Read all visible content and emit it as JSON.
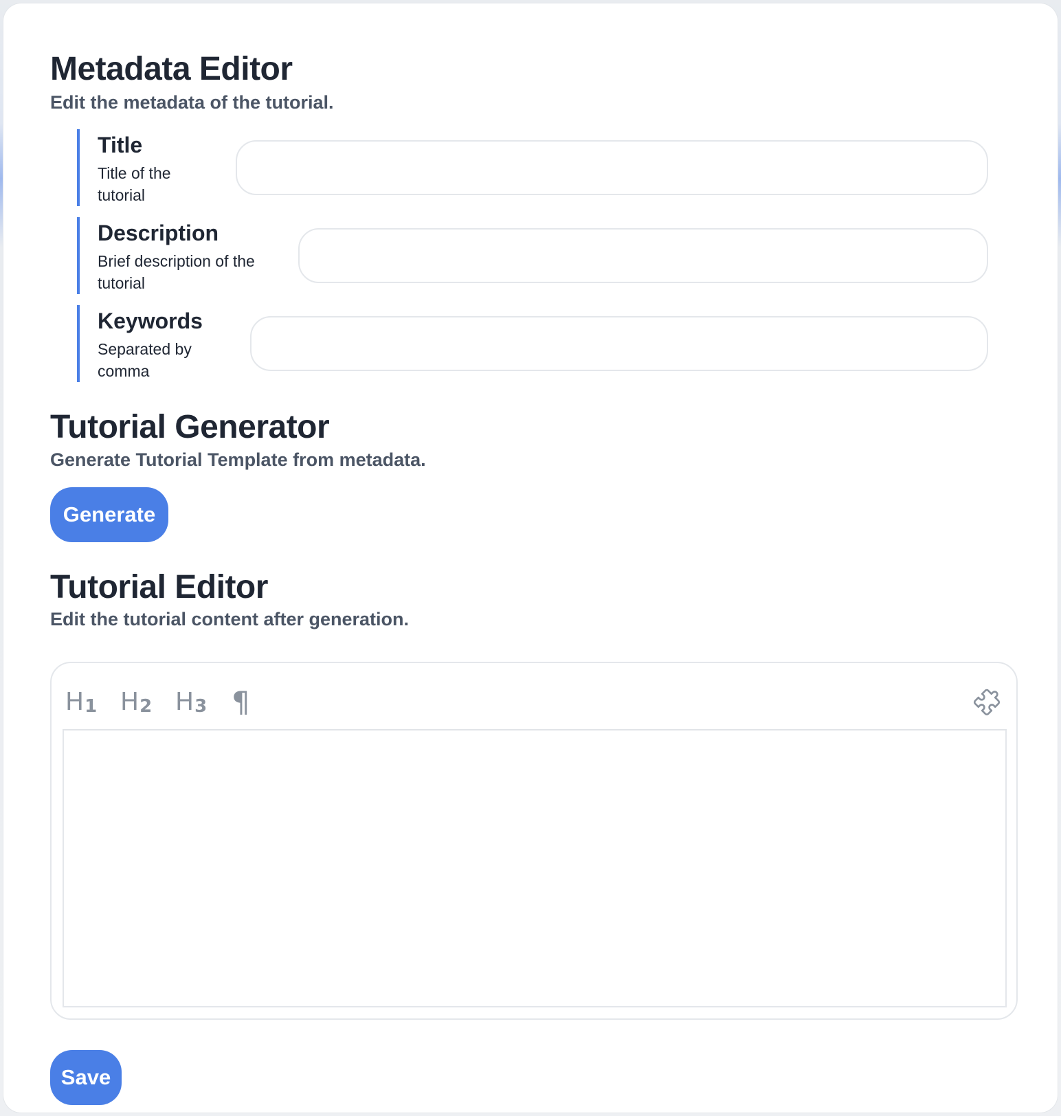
{
  "metadata_section": {
    "title": "Metadata Editor",
    "subtitle": "Edit the metadata of the tutorial.",
    "fields": [
      {
        "label": "Title",
        "help": "Title of the tutorial",
        "value": "",
        "placeholder": ""
      },
      {
        "label": "Description",
        "help": "Brief description of the tutorial",
        "value": "",
        "placeholder": ""
      },
      {
        "label": "Keywords",
        "help": "Separated by comma",
        "value": "",
        "placeholder": ""
      }
    ]
  },
  "generator_section": {
    "title": "Tutorial Generator",
    "subtitle": "Generate Tutorial Template from metadata.",
    "button_label": "Generate"
  },
  "editor_section": {
    "title": "Tutorial Editor",
    "subtitle": "Edit the tutorial content after generation.",
    "toolbar": {
      "h1": "H",
      "h1_sub": "1",
      "h2": "H",
      "h2_sub": "2",
      "h3": "H",
      "h3_sub": "3",
      "paragraph": "¶",
      "extensions_icon": "puzzle-icon"
    },
    "content": ""
  },
  "save_button_label": "Save",
  "colors": {
    "accent": "#4a7fe6",
    "heading": "#1f2633",
    "subtext": "#4b5565",
    "icon": "#8a929d",
    "border": "#e4e7eb"
  }
}
